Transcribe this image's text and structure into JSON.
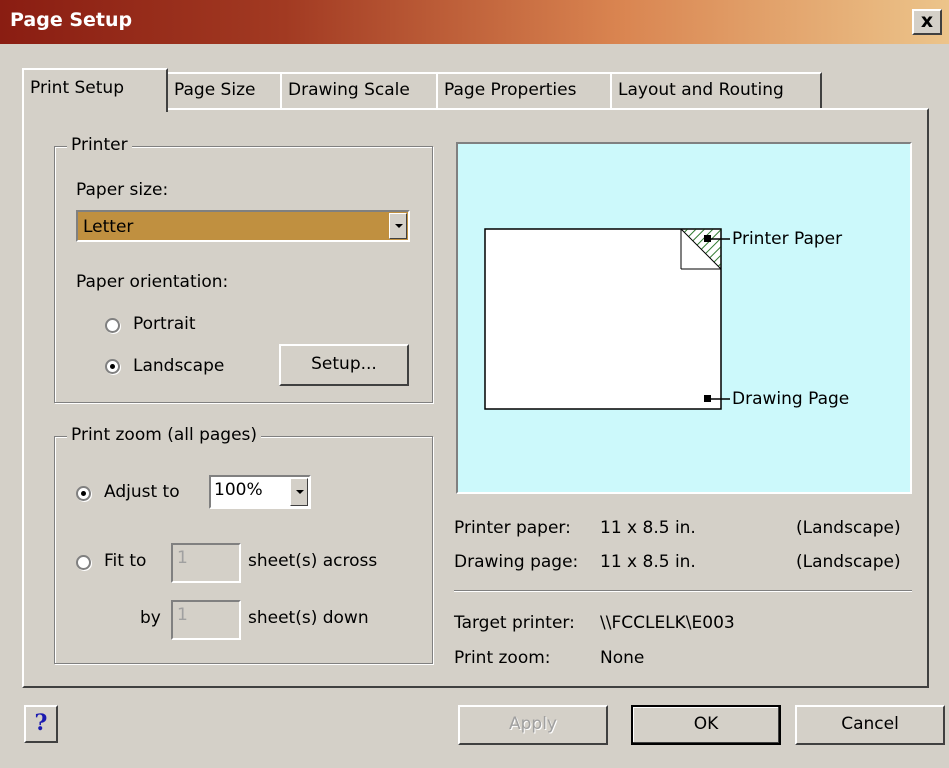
{
  "window": {
    "title": "Page Setup",
    "close_glyph": "x"
  },
  "tabs": [
    {
      "label": "Print Setup",
      "active": true
    },
    {
      "label": "Page Size"
    },
    {
      "label": "Drawing Scale"
    },
    {
      "label": "Page Properties"
    },
    {
      "label": "Layout and Routing"
    }
  ],
  "printer_group": {
    "legend": "Printer",
    "paper_size_label": "Paper size:",
    "paper_size_value": "Letter",
    "orientation_label": "Paper orientation:",
    "portrait_label": "Portrait",
    "landscape_label": "Landscape",
    "selected_orientation": "Landscape",
    "setup_button": "Setup..."
  },
  "zoom_group": {
    "legend": "Print zoom (all pages)",
    "adjust_label": "Adjust to",
    "adjust_value": "100%",
    "fit_label": "Fit to",
    "across_value": "1",
    "across_label": "sheet(s) across",
    "by_label": "by",
    "down_value": "1",
    "down_label": "sheet(s) down",
    "selected": "Adjust to"
  },
  "preview": {
    "printer_paper_label": "Printer Paper",
    "drawing_page_label": "Drawing Page",
    "background_color": "#ccf9fb"
  },
  "info": {
    "printer_paper_key": "Printer paper:",
    "printer_paper_value": "11 x 8.5 in.",
    "printer_paper_orientation": "(Landscape)",
    "drawing_page_key": "Drawing page:",
    "drawing_page_value": "11 x 8.5 in.",
    "drawing_page_orientation": "(Landscape)",
    "target_printer_key": "Target printer:",
    "target_printer_value": "\\\\FCCLELK\\E003",
    "print_zoom_key": "Print zoom:",
    "print_zoom_value": "None"
  },
  "footer": {
    "help_glyph": "?",
    "apply": "Apply",
    "ok": "OK",
    "cancel": "Cancel"
  }
}
